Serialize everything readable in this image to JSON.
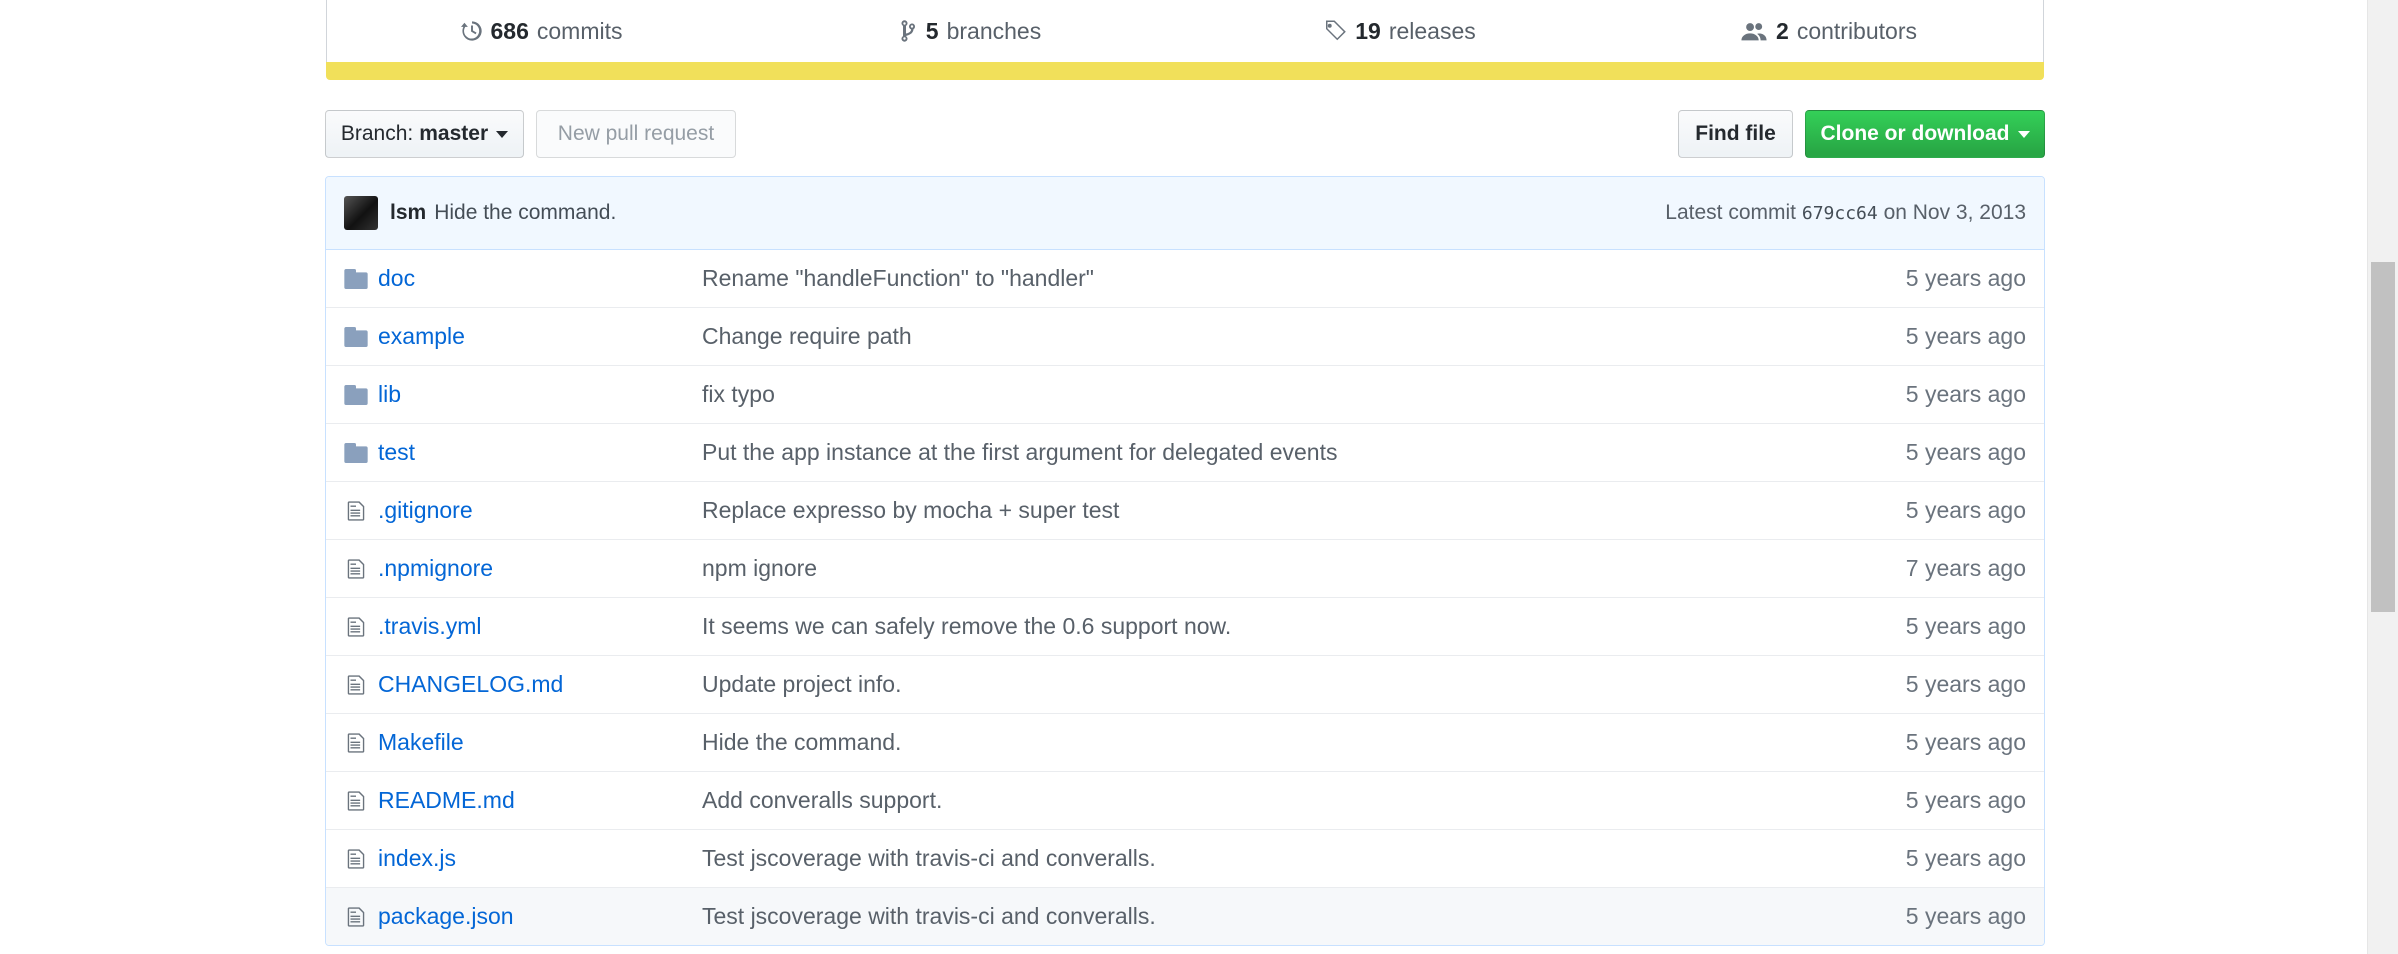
{
  "summary": {
    "commits": {
      "num": "686",
      "label": "commits"
    },
    "branches": {
      "num": "5",
      "label": "branches"
    },
    "releases": {
      "num": "19",
      "label": "releases"
    },
    "contributors": {
      "num": "2",
      "label": "contributors"
    }
  },
  "language_bar_color": "#f1e05a",
  "toolbar": {
    "branch_prefix": "Branch:",
    "branch_name": "master",
    "new_pr": "New pull request",
    "find_file": "Find file",
    "clone": "Clone or download"
  },
  "latest_commit": {
    "author": "lsm",
    "message": "Hide the command.",
    "prefix": "Latest commit",
    "sha": "679cc64",
    "date_text": "on Nov 3, 2013"
  },
  "files": [
    {
      "type": "dir",
      "name": "doc",
      "message": "Rename \"handleFunction\" to \"handler\"",
      "age": "5 years ago"
    },
    {
      "type": "dir",
      "name": "example",
      "message": "Change require path",
      "age": "5 years ago"
    },
    {
      "type": "dir",
      "name": "lib",
      "message": "fix typo",
      "age": "5 years ago"
    },
    {
      "type": "dir",
      "name": "test",
      "message": "Put the app instance at the first argument for delegated events",
      "age": "5 years ago"
    },
    {
      "type": "file",
      "name": ".gitignore",
      "message": "Replace expresso by mocha + super test",
      "age": "5 years ago"
    },
    {
      "type": "file",
      "name": ".npmignore",
      "message": "npm ignore",
      "age": "7 years ago"
    },
    {
      "type": "file",
      "name": ".travis.yml",
      "message": "It seems we can safely remove the 0.6 support now.",
      "age": "5 years ago"
    },
    {
      "type": "file",
      "name": "CHANGELOG.md",
      "message": "Update project info.",
      "age": "5 years ago"
    },
    {
      "type": "file",
      "name": "Makefile",
      "message": "Hide the command.",
      "age": "5 years ago"
    },
    {
      "type": "file",
      "name": "README.md",
      "message": "Add converalls support.",
      "age": "5 years ago"
    },
    {
      "type": "file",
      "name": "index.js",
      "message": "Test jscoverage with travis-ci and converalls.",
      "age": "5 years ago"
    },
    {
      "type": "file",
      "name": "package.json",
      "message": "Test jscoverage with travis-ci and converalls.",
      "age": "5 years ago"
    }
  ]
}
